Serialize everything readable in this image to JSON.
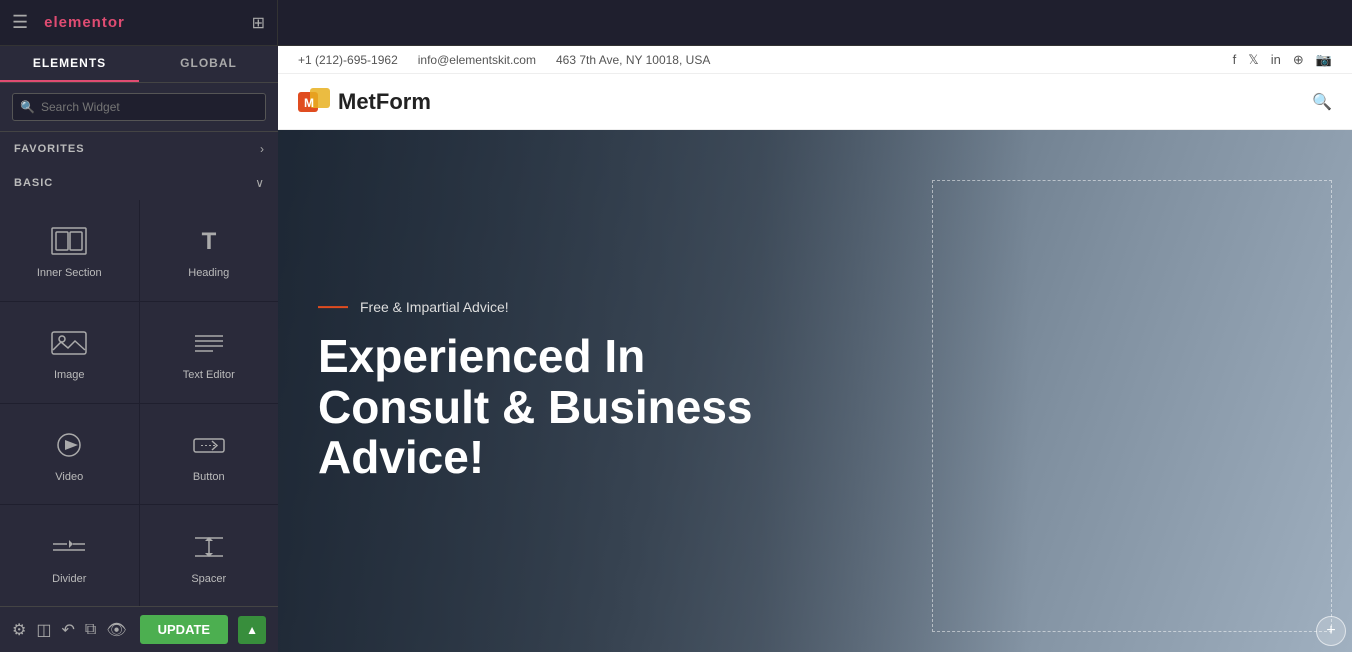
{
  "topbar": {
    "logo": "elementor",
    "menu_icon": "☰",
    "grid_icon": "⊞"
  },
  "sidebar": {
    "tabs": [
      {
        "label": "ELEMENTS",
        "active": true
      },
      {
        "label": "GLOBAL",
        "active": false
      }
    ],
    "search": {
      "placeholder": "Search Widget"
    },
    "sections": [
      {
        "label": "FAVORITES",
        "arrow": "›",
        "widgets": []
      },
      {
        "label": "BASIC",
        "arrow": "∨",
        "widgets": [
          {
            "label": "Inner Section",
            "icon_class": "icon-inner-section"
          },
          {
            "label": "Heading",
            "icon_class": "icon-heading"
          },
          {
            "label": "Image",
            "icon_class": "icon-image"
          },
          {
            "label": "Text Editor",
            "icon_class": "icon-text-editor"
          },
          {
            "label": "Video",
            "icon_class": "icon-video"
          },
          {
            "label": "Button",
            "icon_class": "icon-button"
          },
          {
            "label": "Divider",
            "icon_class": "icon-divider"
          },
          {
            "label": "Spacer",
            "icon_class": "icon-spacer"
          }
        ]
      }
    ],
    "bottom_toolbar": {
      "settings_icon": "⚙",
      "layers_icon": "◫",
      "history_icon": "↶",
      "duplicate_icon": "⧉",
      "preview_icon": "👁",
      "update_label": "UPDATE",
      "update_arrow": "▲"
    }
  },
  "canvas": {
    "contact_bar": {
      "phone": "+1 (212)-695-1962",
      "email": "info@elementskit.com",
      "address": "463 7th Ave, NY 10018, USA",
      "social": [
        "f",
        "𝕏",
        "in",
        "⊕",
        "📷"
      ]
    },
    "nav": {
      "logo_text": "MetForm"
    },
    "hero": {
      "subtitle": "Free & Impartial Advice!",
      "title": "Experienced In\nConsult & Business\nAdvice!"
    }
  },
  "colors": {
    "accent_red": "#e04c72",
    "accent_orange": "#e8611a",
    "sidebar_bg": "#2a2a3a",
    "sidebar_dark": "#1f1f2e",
    "update_green": "#4caf50"
  }
}
